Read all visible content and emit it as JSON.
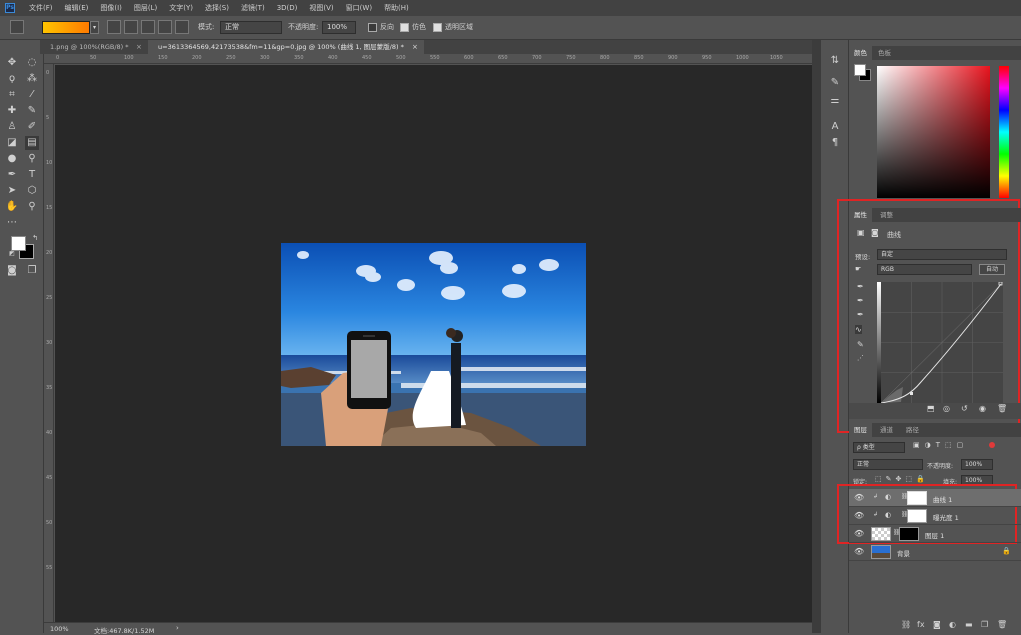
{
  "app": {
    "logo": "Ps"
  },
  "menu": [
    "文件(F)",
    "编辑(E)",
    "图像(I)",
    "图层(L)",
    "文字(Y)",
    "选择(S)",
    "滤镜(T)",
    "3D(D)",
    "视图(V)",
    "窗口(W)",
    "帮助(H)"
  ],
  "options": {
    "mode_label": "模式:",
    "mode_value": "正常",
    "opacity_label": "不透明度:",
    "opacity_value": "100%",
    "reverse_label": "反向",
    "dither_label": "仿色",
    "transparency_label": "透明区域",
    "gradient_start": "#ffc400",
    "gradient_end": "#ff7a00"
  },
  "tabs": [
    {
      "label": "1.png @ 100%(RGB/8) *"
    },
    {
      "label": "u=3613364569,4217353​8&fm=11&gp=0.jpg @ 100% (曲线 1, 图层蒙版/8) *"
    }
  ],
  "status": {
    "zoom": "100%",
    "doc": "文档:467.8K/1.52M"
  },
  "color_panel": {
    "tab_color": "颜色",
    "tab_swatches": "色板"
  },
  "properties_panel": {
    "tab_properties": "属性",
    "tab_adjust": "调整",
    "title": "曲线",
    "preset_label": "预设:",
    "preset_value": "自定",
    "channel_value": "RGB",
    "auto_label": "自动"
  },
  "layers_panel": {
    "tab_layers": "图层",
    "tab_channels": "通道",
    "tab_paths": "路径",
    "kind_label": "ρ 类型",
    "blend_value": "正常",
    "opacity_label": "不透明度:",
    "opacity_value": "100%",
    "lock_label": "锁定:",
    "fill_label": "填充:",
    "fill_value": "100%",
    "layers": [
      {
        "name": "曲线 1",
        "selected": true
      },
      {
        "name": "曝光度 1",
        "selected": false
      },
      {
        "name": "图层 1",
        "selected": false
      },
      {
        "name": "背景",
        "selected": false
      }
    ]
  },
  "rulers": {
    "top": [
      "0",
      "50",
      "100",
      "150",
      "200",
      "250",
      "300",
      "350",
      "400",
      "450",
      "500",
      "550",
      "600",
      "650",
      "700",
      "750",
      "800",
      "850",
      "900",
      "950",
      "1000",
      "1050"
    ],
    "left": [
      "0",
      "5",
      "10",
      "15",
      "20",
      "25",
      "30",
      "35",
      "40",
      "45",
      "50",
      "55"
    ]
  }
}
